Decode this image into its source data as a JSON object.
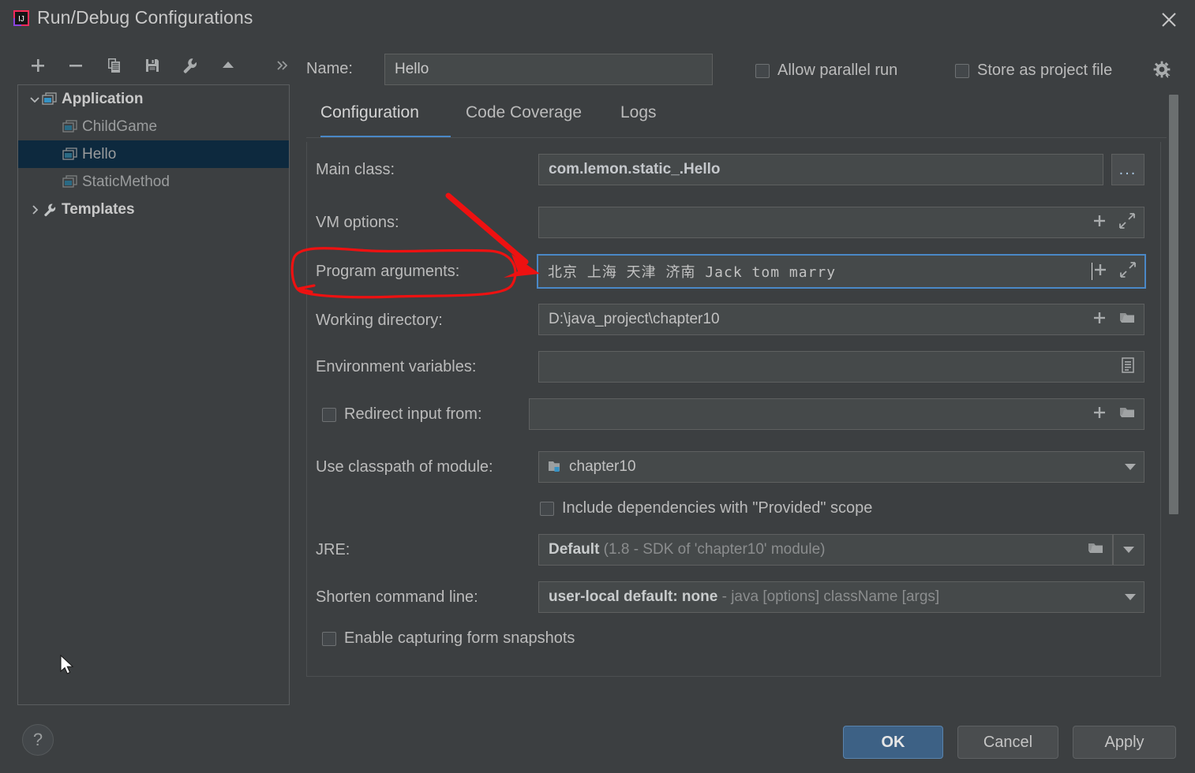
{
  "window": {
    "title": "Run/Debug Configurations",
    "close_label": "Close",
    "app_icon": "intellij-idea-icon"
  },
  "toolbar": {
    "items": [
      {
        "name": "add",
        "icon": "plus-icon",
        "tooltip": "Add New Configuration"
      },
      {
        "name": "remove",
        "icon": "minus-icon",
        "tooltip": "Remove Configuration"
      },
      {
        "name": "copy",
        "icon": "copy-icon",
        "tooltip": "Copy Configuration"
      },
      {
        "name": "save",
        "icon": "save-icon",
        "tooltip": "Save Configuration"
      },
      {
        "name": "edit-templates",
        "icon": "wrench-icon",
        "tooltip": "Edit Templates"
      },
      {
        "name": "move-up",
        "icon": "arrow-up-icon",
        "tooltip": "Move Up"
      },
      {
        "name": "more",
        "icon": "chevron-double-right-icon",
        "tooltip": "More"
      }
    ]
  },
  "tree": {
    "nodes": [
      {
        "label": "Application",
        "icon": "application-icon",
        "level": 0,
        "expanded": true,
        "selected": false,
        "bold": true,
        "dim": false
      },
      {
        "label": "ChildGame",
        "icon": "run-config-icon",
        "level": 1,
        "expanded": null,
        "selected": false,
        "bold": false,
        "dim": true
      },
      {
        "label": "Hello",
        "icon": "run-config-icon",
        "level": 1,
        "expanded": null,
        "selected": true,
        "bold": false,
        "dim": true
      },
      {
        "label": "StaticMethod",
        "icon": "run-config-icon",
        "level": 1,
        "expanded": null,
        "selected": false,
        "bold": false,
        "dim": true
      },
      {
        "label": "Templates",
        "icon": "wrench-icon",
        "level": 0,
        "expanded": false,
        "selected": false,
        "bold": true,
        "dim": false
      }
    ]
  },
  "header": {
    "name_label": "Name:",
    "name_value": "Hello",
    "name_placeholder": "",
    "allow_parallel_run": {
      "label": "Allow parallel run",
      "checked": false
    },
    "store_as_project_file": {
      "label": "Store as project file",
      "checked": false
    },
    "settings_icon": "gear-icon"
  },
  "tabs": {
    "items": [
      {
        "label": "Configuration",
        "active": true
      },
      {
        "label": "Code Coverage",
        "active": false
      },
      {
        "label": "Logs",
        "active": false
      }
    ],
    "active_underline_color": "#4a88c7"
  },
  "form": {
    "main_class": {
      "label": "Main class:",
      "value": "com.lemon.static_.Hello",
      "browse_label": "..."
    },
    "vm_options": {
      "label": "VM options:",
      "value": "",
      "buttons": [
        "macro-plus-icon",
        "expand-icon"
      ]
    },
    "program_arguments": {
      "label": "Program arguments:",
      "value": "北京 上海 天津 济南 Jack tom marry",
      "focused": true,
      "buttons": [
        "macro-plus-icon",
        "expand-icon"
      ]
    },
    "working_directory": {
      "label": "Working directory:",
      "value": "D:\\java_project\\chapter10",
      "buttons": [
        "macro-plus-icon",
        "folder-icon"
      ]
    },
    "environment_variables": {
      "label": "Environment variables:",
      "value": "",
      "buttons": [
        "env-list-icon"
      ]
    },
    "redirect_input": {
      "label": "Redirect input from:",
      "value": "",
      "checked": false,
      "buttons": [
        "macro-plus-icon",
        "folder-icon"
      ]
    },
    "classpath_module": {
      "label": "Use classpath of module:",
      "value": "chapter10",
      "icon": "module-folder-icon"
    },
    "include_provided": {
      "label": "Include dependencies with \"Provided\" scope",
      "checked": false
    },
    "jre": {
      "label": "JRE:",
      "value_main": "Default",
      "value_dim": " (1.8 - SDK of 'chapter10' module)"
    },
    "shorten_command_line": {
      "label": "Shorten command line:",
      "value_main": "user-local default: none",
      "value_dim": " - java [options] className [args]"
    },
    "enable_snapshots": {
      "label": "Enable capturing form snapshots",
      "checked": false
    }
  },
  "footer": {
    "help_label": "?",
    "ok_label": "OK",
    "cancel_label": "Cancel",
    "apply_label": "Apply"
  },
  "annotations": {
    "ellipse_target": "Program arguments:",
    "arrow_target": "program-arguments-input",
    "color": "#ee1111"
  },
  "colors": {
    "background": "#3c3f41",
    "field_background": "#45494a",
    "accent": "#4a88c7",
    "selection": "#0d293e",
    "text": "#bbbbbb",
    "annotation_red": "#ee1111"
  }
}
